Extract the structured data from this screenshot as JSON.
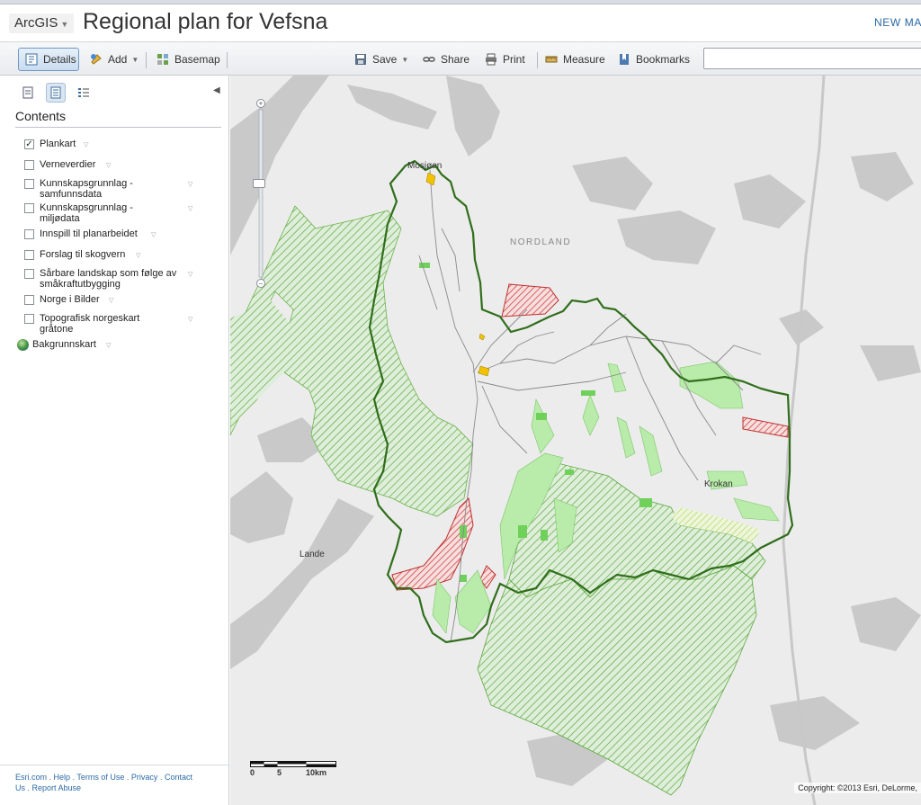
{
  "header": {
    "brand": "ArcGIS",
    "title": "Regional plan for Vefsna",
    "new_map": "NEW MA"
  },
  "toolbar": {
    "details": "Details",
    "add": "Add",
    "basemap": "Basemap",
    "save": "Save",
    "share": "Share",
    "print": "Print",
    "measure": "Measure",
    "bookmarks": "Bookmarks",
    "search_value": ""
  },
  "sidebar": {
    "contents_title": "Contents",
    "layers": [
      {
        "line1": "Plankart",
        "line2": "",
        "checked": true
      },
      {
        "line1": "Verneverdier",
        "line2": "",
        "checked": false
      },
      {
        "line1": "Kunnskapsgrunnlag -",
        "line2": "samfunnsdata",
        "checked": false
      },
      {
        "line1": "Kunnskapsgrunnlag -",
        "line2": "miljødata",
        "checked": false
      },
      {
        "line1": "Innspill til planarbeidet",
        "line2": "",
        "checked": false
      },
      {
        "line1": "Forslag til skogvern",
        "line2": "",
        "checked": false
      },
      {
        "line1": "Sårbare landskap som følge av",
        "line2": "småkraftutbygging",
        "checked": false
      },
      {
        "line1": "Norge i Bilder",
        "line2": "",
        "checked": false
      },
      {
        "line1": "Topografisk norgeskart",
        "line2": "gråtone",
        "checked": false
      }
    ],
    "basemap_layer": "Bakgrunnskart",
    "footer": {
      "esri": "Esri.com",
      "help": "Help",
      "terms": "Terms of Use",
      "privacy": "Privacy",
      "contact": "Contact",
      "us": "Us",
      "report": "Report Abuse"
    }
  },
  "map": {
    "labels": {
      "mosjoen": "Mosjøen",
      "nordland": "NORDLAND",
      "krokan": "Krokan",
      "lande": "Lande"
    },
    "scale": {
      "t0": "0",
      "t1": "5",
      "t2": "10km"
    },
    "copyright": "Copyright: ©2013 Esri, DeLorme,"
  },
  "colors": {
    "accent": "#2b6aa6",
    "forest_hatch": "#5aa83a",
    "red_hatch": "#d23030",
    "boundary": "#2f6e1a",
    "light_green": "#b9ecaa",
    "water": "#c9c9c9"
  }
}
